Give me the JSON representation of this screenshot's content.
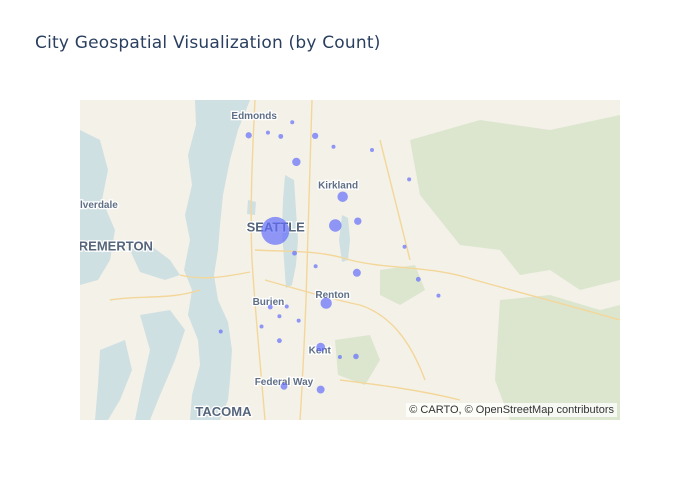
{
  "chart_title": "City Geospatial Visualization (by Count)",
  "attribution": "© CARTO, © OpenStreetMap contributors",
  "map": {
    "basemap": "carto-positron",
    "marker_color": "#636efa",
    "water_color": "#cfe0e3",
    "land_color": "#f4f1e8",
    "park_color": "#dce6cf",
    "road_color": "#f3d79a",
    "place_labels": [
      {
        "id": "edmonds",
        "text": "Edmonds",
        "lat": 47.812,
        "lon": -122.378,
        "size": "small"
      },
      {
        "id": "silverdale",
        "text": "Silverdale",
        "lat": 47.648,
        "lon": -122.727,
        "size": "small"
      },
      {
        "id": "kirkland",
        "text": "Kirkland",
        "lat": 47.684,
        "lon": -122.195,
        "size": "small"
      },
      {
        "id": "seattle",
        "text": "SEATTLE",
        "lat": 47.605,
        "lon": -122.331,
        "size": "large"
      },
      {
        "id": "bremerton",
        "text": "BREMERTON",
        "lat": 47.57,
        "lon": -122.69,
        "size": "large"
      },
      {
        "id": "burien",
        "text": "Burien",
        "lat": 47.47,
        "lon": -122.347,
        "size": "small"
      },
      {
        "id": "renton",
        "text": "Renton",
        "lat": 47.483,
        "lon": -122.207,
        "size": "small"
      },
      {
        "id": "kent",
        "text": "Kent",
        "lat": 47.38,
        "lon": -122.235,
        "size": "small"
      },
      {
        "id": "federal-way",
        "text": "Federal Way",
        "lat": 47.322,
        "lon": -122.313,
        "size": "small"
      },
      {
        "id": "tacoma",
        "text": "TACOMA",
        "lat": 47.265,
        "lon": -122.445,
        "size": "large"
      }
    ]
  },
  "chart_data": {
    "type": "scatter",
    "subtype": "scatter_mapbox",
    "title": "City Geospatial Visualization (by Count)",
    "center": {
      "lat": 47.55,
      "lon": -122.2
    },
    "points": [
      {
        "lat": 47.606,
        "lon": -122.332,
        "count": 100
      },
      {
        "lat": 47.782,
        "lon": -122.39,
        "count": 5
      },
      {
        "lat": 47.787,
        "lon": -122.348,
        "count": 2
      },
      {
        "lat": 47.78,
        "lon": -122.32,
        "count": 3
      },
      {
        "lat": 47.806,
        "lon": -122.295,
        "count": 1
      },
      {
        "lat": 47.781,
        "lon": -122.245,
        "count": 5
      },
      {
        "lat": 47.761,
        "lon": -122.205,
        "count": 1
      },
      {
        "lat": 47.733,
        "lon": -122.286,
        "count": 9
      },
      {
        "lat": 47.669,
        "lon": -122.185,
        "count": 14
      },
      {
        "lat": 47.755,
        "lon": -122.121,
        "count": 1
      },
      {
        "lat": 47.616,
        "lon": -122.201,
        "count": 20
      },
      {
        "lat": 47.624,
        "lon": -122.152,
        "count": 7
      },
      {
        "lat": 47.701,
        "lon": -122.04,
        "count": 1
      },
      {
        "lat": 47.565,
        "lon": -122.29,
        "count": 3
      },
      {
        "lat": 47.541,
        "lon": -122.244,
        "count": 1
      },
      {
        "lat": 47.529,
        "lon": -122.154,
        "count": 8
      },
      {
        "lat": 47.577,
        "lon": -122.05,
        "count": 1
      },
      {
        "lat": 47.517,
        "lon": -122.02,
        "count": 3
      },
      {
        "lat": 47.487,
        "lon": -121.976,
        "count": 2
      },
      {
        "lat": 47.473,
        "lon": -122.221,
        "count": 16
      },
      {
        "lat": 47.466,
        "lon": -122.343,
        "count": 3
      },
      {
        "lat": 47.467,
        "lon": -122.307,
        "count": 1
      },
      {
        "lat": 47.449,
        "lon": -122.323,
        "count": 1
      },
      {
        "lat": 47.441,
        "lon": -122.281,
        "count": 1
      },
      {
        "lat": 47.43,
        "lon": -122.362,
        "count": 1
      },
      {
        "lat": 47.421,
        "lon": -122.451,
        "count": 2
      },
      {
        "lat": 47.404,
        "lon": -122.323,
        "count": 3
      },
      {
        "lat": 47.392,
        "lon": -122.233,
        "count": 10
      },
      {
        "lat": 47.374,
        "lon": -122.191,
        "count": 2
      },
      {
        "lat": 47.375,
        "lon": -122.156,
        "count": 4
      },
      {
        "lat": 47.32,
        "lon": -122.313,
        "count": 6
      },
      {
        "lat": 47.314,
        "lon": -122.233,
        "count": 8
      }
    ]
  }
}
